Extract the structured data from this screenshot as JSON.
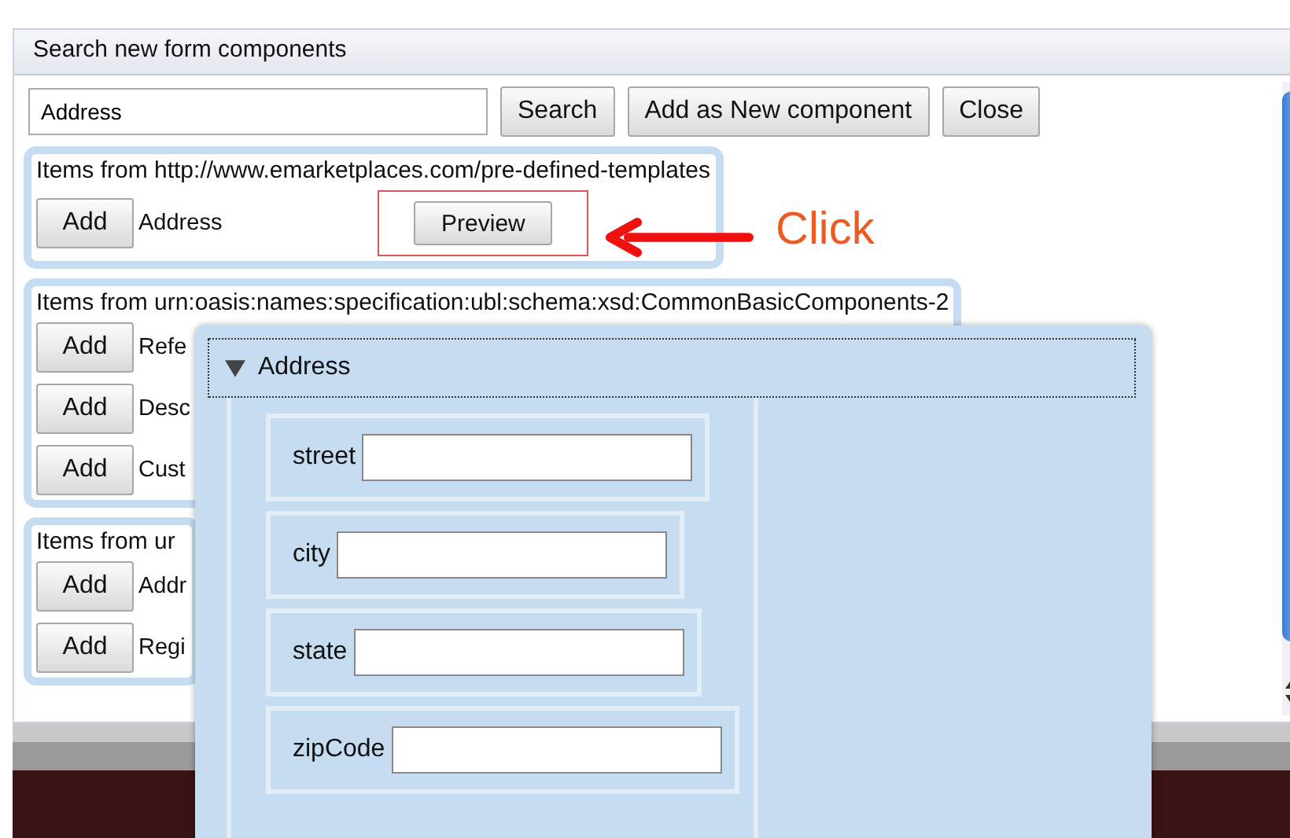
{
  "dialog": {
    "title": "Search new form components",
    "search": {
      "value": "Address"
    },
    "buttons": [
      "Search",
      "Add as New component",
      "Close"
    ],
    "groups": [
      {
        "heading": "Items from http://www.emarketplaces.com/pre-defined-templates",
        "items": [
          {
            "add": "Add",
            "name": "Address",
            "preview": "Preview"
          }
        ]
      },
      {
        "heading": "Items from urn:oasis:names:specification:ubl:schema:xsd:CommonBasicComponents-2",
        "items": [
          {
            "add": "Add",
            "name": "Refe"
          },
          {
            "add": "Add",
            "name": "Desc"
          },
          {
            "add": "Add",
            "name": "Cust"
          }
        ]
      },
      {
        "heading": "Items from ur",
        "items": [
          {
            "add": "Add",
            "name": "Addr"
          },
          {
            "add": "Add",
            "name": "Regi"
          }
        ]
      }
    ]
  },
  "annotation": {
    "text": "Click"
  },
  "preview": {
    "title": "Address",
    "expanded": true,
    "fields": [
      {
        "label": "street"
      },
      {
        "label": "city"
      },
      {
        "label": "state"
      },
      {
        "label": "zipCode"
      }
    ]
  }
}
